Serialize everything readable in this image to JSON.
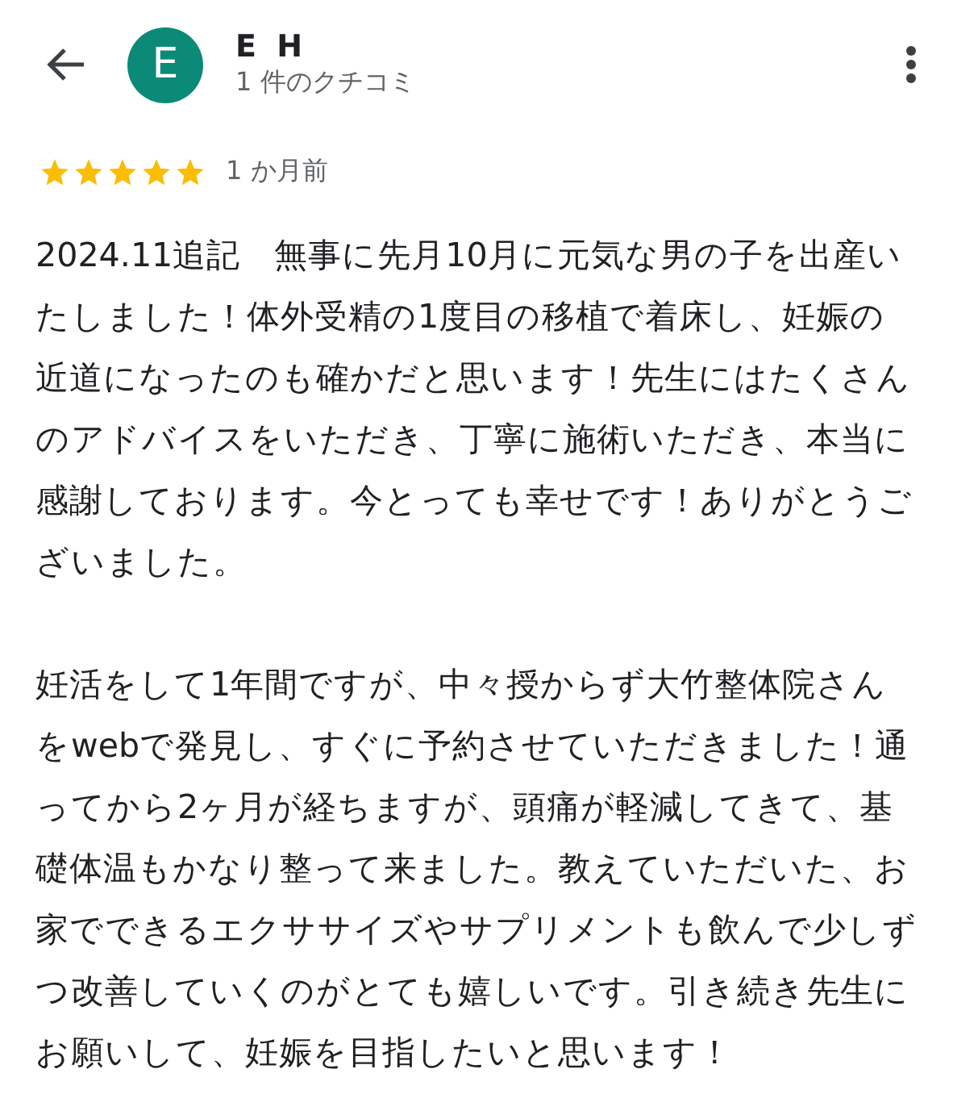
{
  "header": {
    "avatar_letter": "E",
    "name": "E H",
    "subtitle": "1 件のクチコミ"
  },
  "review": {
    "stars": 5,
    "time": "1 か月前",
    "paragraphs": [
      "2024.11追記　無事に先月10月に元気な男の子を出産いたしました！体外受精の1度目の移植で着床し、妊娠の近道になったのも確かだと思います！先生にはたくさんのアドバイスをいただき、丁寧に施術いただき、本当に感謝しております。今とっても幸せです！ありがとうございました。",
      "妊活をして1年間ですが、中々授からず大竹整体院さんをwebで発見し、すぐに予約させていただきました！通ってから2ヶ月が経ちますが、頭痛が軽減してきて、基礎体温もかなり整って来ました。教えていただいた、お家でできるエクササイズやサプリメントも飲んで少しずつ改善していくのがとても嬉しいです。引き続き先生にお願いして、妊娠を目指したいと思います！"
    ]
  }
}
